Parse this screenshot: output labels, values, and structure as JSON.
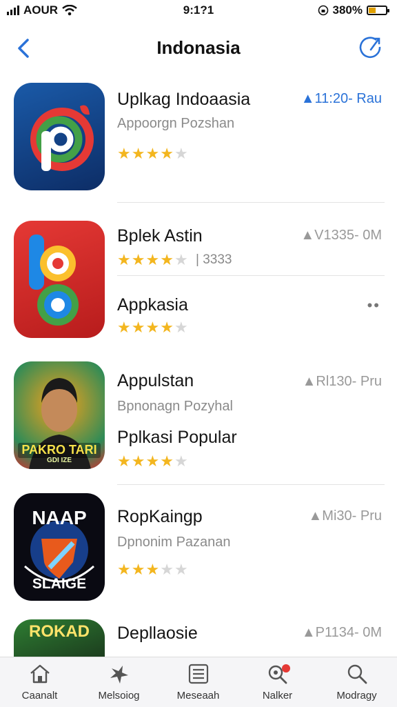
{
  "status_bar": {
    "carrier": "AOUR",
    "time": "9:1?1",
    "battery": "380%"
  },
  "nav": {
    "title": "Indonasia"
  },
  "apps": [
    {
      "title": "Uplkag Indoaasia",
      "subtitle": "Appoorgn Pozshan",
      "meta": "11:20- Rau",
      "rating": 4
    },
    {
      "title": "Bplek Astin",
      "count": "| 3333",
      "meta": "V1335- 0M",
      "title2": "Appkasia",
      "more": "••",
      "rating": 4,
      "rating2": 4
    },
    {
      "title": "Appulstan",
      "subtitle": "Bpnonagn Pozyhal",
      "meta": "Rl130- Pru",
      "title2": "Pplkasi Popular",
      "rating": 4,
      "icon_text": "PAKRO TARI",
      "icon_sub": "GDI IZE"
    },
    {
      "title": "RopKaingp",
      "subtitle": "Dpnonim Pazanan",
      "meta": "Mi30- Pru",
      "rating": 3,
      "icon_text_top": "NAAP",
      "icon_text_bottom": "SLAIGE"
    },
    {
      "title": "Depllaosie",
      "meta": "P1134- 0M",
      "icon_text": "ROKAD"
    }
  ],
  "tabs": [
    {
      "label": "Caanalt",
      "icon": "home-icon"
    },
    {
      "label": "Melsoiog",
      "icon": "star-burst-icon"
    },
    {
      "label": "Meseaah",
      "icon": "list-icon"
    },
    {
      "label": "Nalker",
      "icon": "search-notification-icon"
    },
    {
      "label": "Modragy",
      "icon": "search-icon"
    }
  ]
}
